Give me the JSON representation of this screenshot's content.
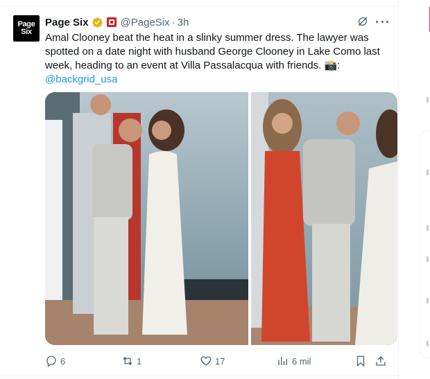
{
  "tweet": {
    "author_name": "Page Six",
    "author_handle": "@PageSix",
    "time": "3h",
    "separator": "·",
    "avatar_text_line1": "Page",
    "avatar_text_line2": "Six",
    "body": "Amal Clooney beat the heat in a slinky summer dress. The lawyer was spotted on a date night with husband George Clooney in Lake Como last week, heading to an event at Villa Passalacqua with friends. 📸:",
    "link": "@backgrid_usa",
    "verified_icon": "gold-verified-badge-icon",
    "affiliate_icon": "page-six-affiliate-badge-icon"
  },
  "actions": {
    "replies": "6",
    "reposts": "1",
    "likes": "17",
    "views": "6 mil"
  },
  "colors": {
    "link": "#1d9bf0",
    "muted": "#536471",
    "gold": "#e2b719",
    "affiliate_red": "#d31f26"
  }
}
